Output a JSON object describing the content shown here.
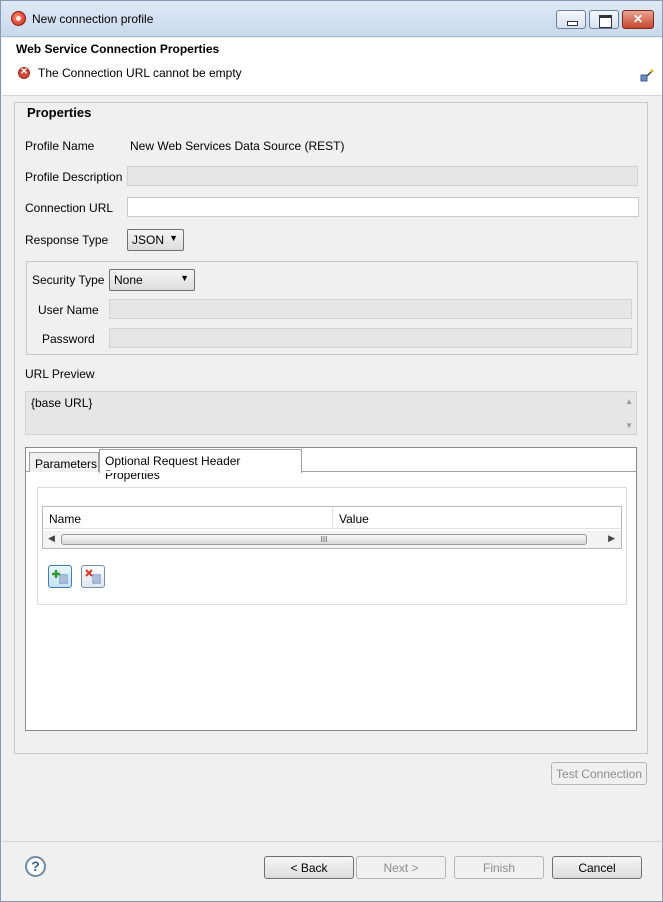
{
  "window": {
    "title": "New connection profile"
  },
  "header": {
    "title": "Web Service Connection Properties",
    "error_message": "The Connection URL cannot be empty"
  },
  "properties": {
    "group_label": "Properties",
    "profile_name_label": "Profile Name",
    "profile_name_value": "New Web Services Data Source (REST)",
    "profile_description_label": "Profile Description",
    "profile_description_value": "",
    "connection_url_label": "Connection URL",
    "connection_url_value": "",
    "response_type_label": "Response Type",
    "response_type_value": "JSON",
    "security_type_label": "Security Type",
    "security_type_value": "None",
    "user_name_label": "User Name",
    "user_name_value": "",
    "password_label": "Password",
    "password_value": "",
    "url_preview_label": "URL Preview",
    "url_preview_value": "{base URL}"
  },
  "tabs": [
    {
      "label": "Parameters",
      "selected": false
    },
    {
      "label": "Optional Request Header Properties",
      "selected": true
    }
  ],
  "header_table": {
    "columns": [
      "Name",
      "Value"
    ],
    "rows": [],
    "scroll_thumb_glyph": "III"
  },
  "icons": {
    "add": "add-row-icon",
    "remove": "remove-row-icon",
    "help": "help-icon",
    "error": "error-icon"
  },
  "buttons": {
    "test_connection": "Test Connection",
    "back": "< Back",
    "next": "Next >",
    "finish": "Finish",
    "cancel": "Cancel",
    "help_glyph": "?"
  }
}
